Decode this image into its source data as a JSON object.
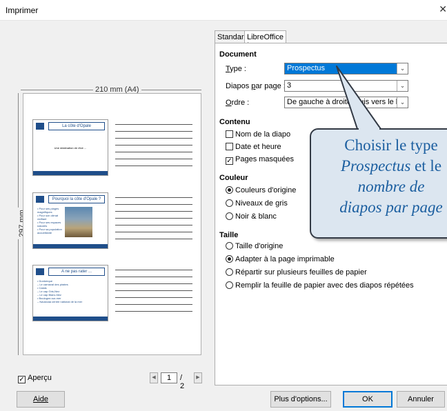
{
  "window": {
    "title": "Imprimer",
    "close_glyph": "✕"
  },
  "preview": {
    "width_label": "210 mm (A4)",
    "height_label": "297 mm",
    "slides": [
      {
        "title": "La côte d'Opale",
        "body": [
          "Une destination de rêve ..."
        ]
      },
      {
        "title": "Pourquoi la côte d'Opale ?",
        "body": [
          "• Pour ses plages magnifiques",
          "• Pour son climat vivifiant",
          "• Pour ses espaces naturels",
          "• Pour sa population accueillante"
        ]
      },
      {
        "title": "A ne pas rater ...",
        "body": [
          "• Dunkerque",
          "  – Le carnaval des pirates",
          "• Calais",
          "  – Le cap Gris-Nez",
          "  – Le cap Blanc-Nez",
          "• Boulogne-sur-mer",
          "  – Nausicaa centre national de la mer"
        ]
      }
    ]
  },
  "tabs": [
    {
      "label": "Standard",
      "active": false
    },
    {
      "label": "LibreOffice Impress",
      "active": true
    }
  ],
  "document": {
    "section": "Document",
    "type_label": "Type :",
    "type_value": "Prospectus",
    "per_page_label": "Diapos par page :",
    "per_page_value": "3",
    "order_label": "Ordre :",
    "order_value": "De gauche à droite, puis vers le bas"
  },
  "contenu": {
    "section": "Contenu",
    "items": [
      {
        "label": "Nom de la diapo",
        "checked": false
      },
      {
        "label": "Date et heure",
        "checked": false
      },
      {
        "label": "Pages masquées",
        "checked": true
      }
    ]
  },
  "couleur": {
    "section": "Couleur",
    "items": [
      {
        "label": "Couleurs d'origine",
        "selected": true
      },
      {
        "label": "Niveaux de gris",
        "selected": false
      },
      {
        "label": "Noir & blanc",
        "selected": false
      }
    ]
  },
  "taille": {
    "section": "Taille",
    "items": [
      {
        "label": "Taille d'origine",
        "selected": false
      },
      {
        "label": "Adapter à la page imprimable",
        "selected": true
      },
      {
        "label": "Répartir sur plusieurs feuilles de papier",
        "selected": false
      },
      {
        "label": "Remplir la feuille de papier avec des diapos répétées",
        "selected": false
      }
    ]
  },
  "callout": {
    "line1": "Choisir le type",
    "line2_italic": "Prospectus",
    "line2_rest": " et le",
    "line3": "nombre de",
    "line4": "diapos par page"
  },
  "bottom": {
    "apercu_label": "Aperçu",
    "apercu_checked": true,
    "page_current": "1",
    "page_total": "/ 2",
    "help": "Aide",
    "more": "Plus d'options...",
    "ok": "OK",
    "cancel": "Annuler"
  },
  "colors": {
    "accent": "#0078d7",
    "callout_text": "#1c5fa0",
    "callout_bg": "#dce6f0",
    "slide_theme": "#1f4e8a"
  }
}
